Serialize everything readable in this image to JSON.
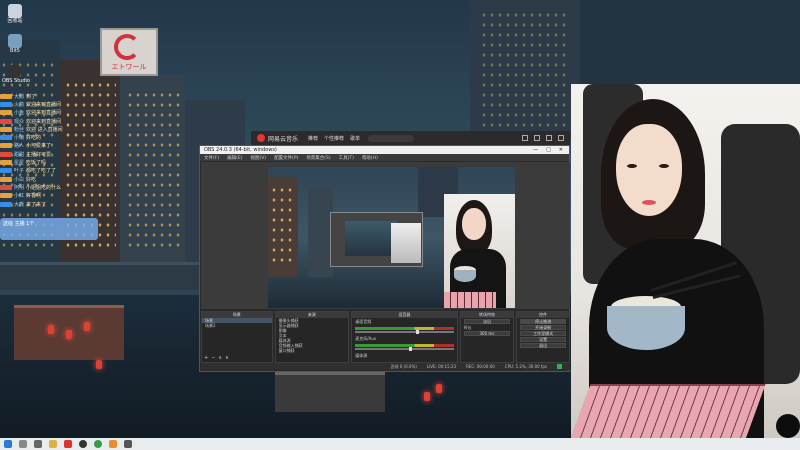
{
  "desktop": {
    "icons": [
      {
        "label": "回收站",
        "icon": "recycle-bin-icon"
      },
      {
        "label": "Bit5",
        "icon": "app-icon"
      },
      {
        "label": "OBS Studio",
        "icon": "obs-icon"
      }
    ],
    "sign_text": "エトワール"
  },
  "chat_overlay": {
    "lines": [
      {
        "user": "大鹅",
        "msg": "到了"
      },
      {
        "user": "火箭",
        "msg": "欢迎来到直播间"
      },
      {
        "user": "小鱼",
        "msg": "欢迎来到直播间"
      },
      {
        "user": "观众",
        "msg": "欢迎来到直播间"
      },
      {
        "user": "粉丝",
        "msg": "欢迎 进入直播间"
      },
      {
        "user": "小懒",
        "msg": "好吃的"
      },
      {
        "user": "路人",
        "msg": "小可爱来了"
      },
      {
        "user": "甜甜",
        "msg": "主播好可爱"
      },
      {
        "user": "星星",
        "msg": "吃饭了吗"
      },
      {
        "user": "叶子",
        "msg": "都吃了吃了了"
      },
      {
        "user": "小白",
        "msg": "好吃"
      },
      {
        "user": "阿明",
        "msg": "小姐姐吃的什么"
      },
      {
        "user": "小红",
        "msg": "好香啊"
      },
      {
        "user": "大熊",
        "msg": "来了来了"
      }
    ],
    "gift_label": "送给 主播 1个"
  },
  "netease": {
    "title": "网易云音乐",
    "menu": [
      "推荐",
      "个性推荐",
      "歌单"
    ]
  },
  "obs": {
    "title": "OBS 24.0.3 (64-bit, windows)",
    "window_controls": [
      "—",
      "□",
      "✕"
    ],
    "menu": [
      "文件(F)",
      "编辑(E)",
      "视图(V)",
      "配置文件(P)",
      "场景集合(S)",
      "工具(T)",
      "帮助(H)"
    ],
    "docks": {
      "scenes": {
        "header": "场景",
        "items": [
          "场景",
          "场景2"
        ]
      },
      "sources": {
        "header": "来源",
        "items": [
          "摄像头捕获",
          "显示器捕获",
          "图像",
          "文本",
          "媒体源",
          "音频输入捕获",
          "窗口捕获"
        ]
      },
      "mixer": {
        "header": "混音器",
        "channels": [
          {
            "name": "桌面音频",
            "level": 0.62
          },
          {
            "name": "麦克风/Aux",
            "level": 0.55
          },
          {
            "name": "媒体源",
            "level": 0.48
          }
        ]
      },
      "transitions": {
        "header": "转场特效",
        "mode": "淡出",
        "duration_label": "时长",
        "duration_value": "300 ms"
      },
      "controls": {
        "header": "控件",
        "buttons": [
          "停止推流",
          "开始录制",
          "工作室模式",
          "设置",
          "退出"
        ]
      }
    },
    "status": {
      "dropped": "丢帧 0 (0.0%)",
      "live": "LIVE: 00:15:23",
      "rec": "REC: 00:00:00",
      "cpu": "CPU: 5.2%, 30.00 fps"
    }
  },
  "taskbar": {
    "icons": [
      "windows-start-icon",
      "search-icon",
      "taskview-icon",
      "file-explorer-icon",
      "netease-icon",
      "obs-icon",
      "chrome-icon",
      "folder-icon",
      "app-icon"
    ]
  },
  "colors": {
    "accent_live": "#2fb44a",
    "obs_bg": "#2a2a2a",
    "netease_red": "#e33333"
  }
}
